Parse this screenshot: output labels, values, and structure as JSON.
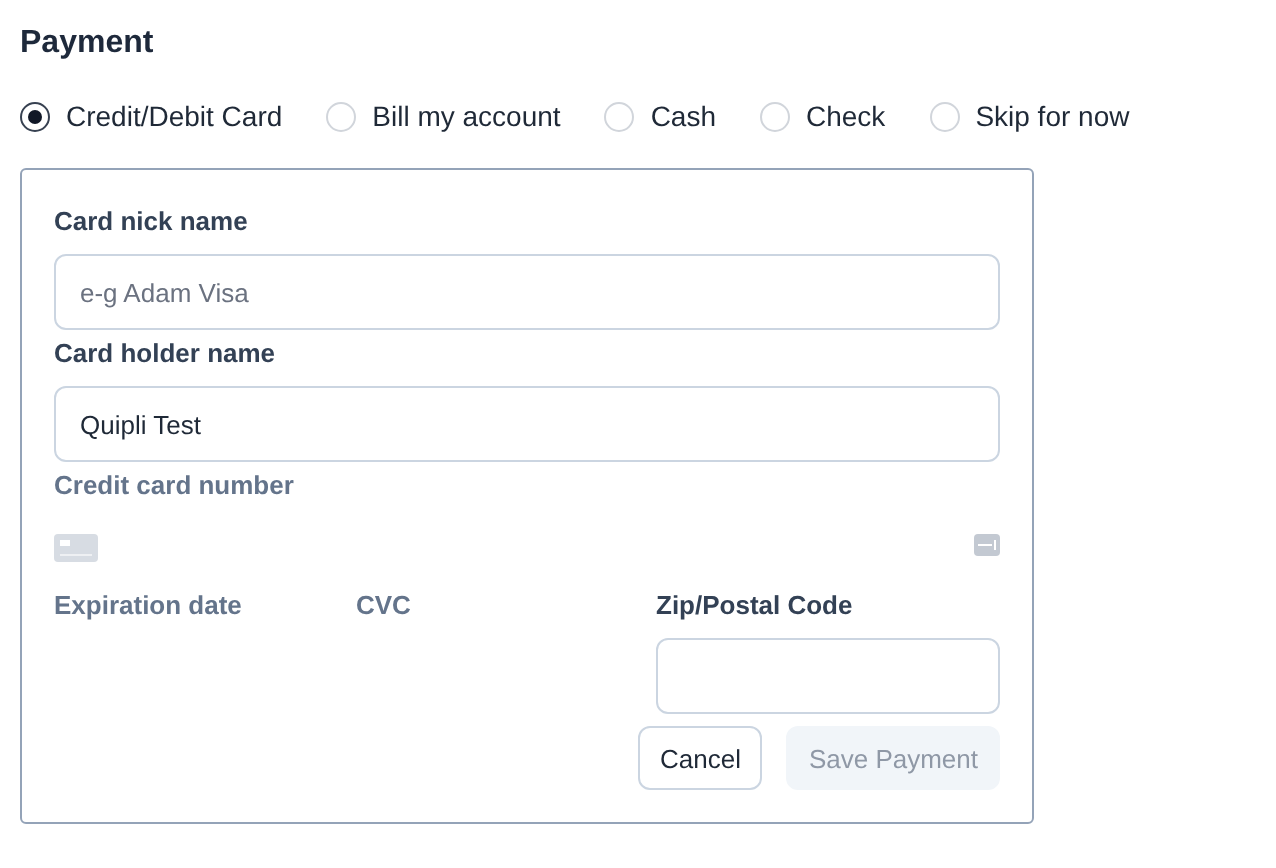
{
  "title": "Payment",
  "methods": [
    {
      "label": "Credit/Debit Card",
      "selected": true
    },
    {
      "label": "Bill my account",
      "selected": false
    },
    {
      "label": "Cash",
      "selected": false
    },
    {
      "label": "Check",
      "selected": false
    },
    {
      "label": "Skip for now",
      "selected": false
    }
  ],
  "form": {
    "nick_name": {
      "label": "Card nick name",
      "placeholder": "e-g Adam Visa"
    },
    "holder_name": {
      "label": "Card holder name",
      "value": "Quipli Test"
    },
    "card_number": {
      "label": "Credit card number"
    },
    "expiration": {
      "label": "Expiration date"
    },
    "cvc": {
      "label": "CVC"
    },
    "zip": {
      "label": "Zip/Postal Code"
    }
  },
  "buttons": [
    {
      "label": "Cancel",
      "disabled": false
    },
    {
      "label": "Save Payment",
      "disabled": true
    }
  ]
}
